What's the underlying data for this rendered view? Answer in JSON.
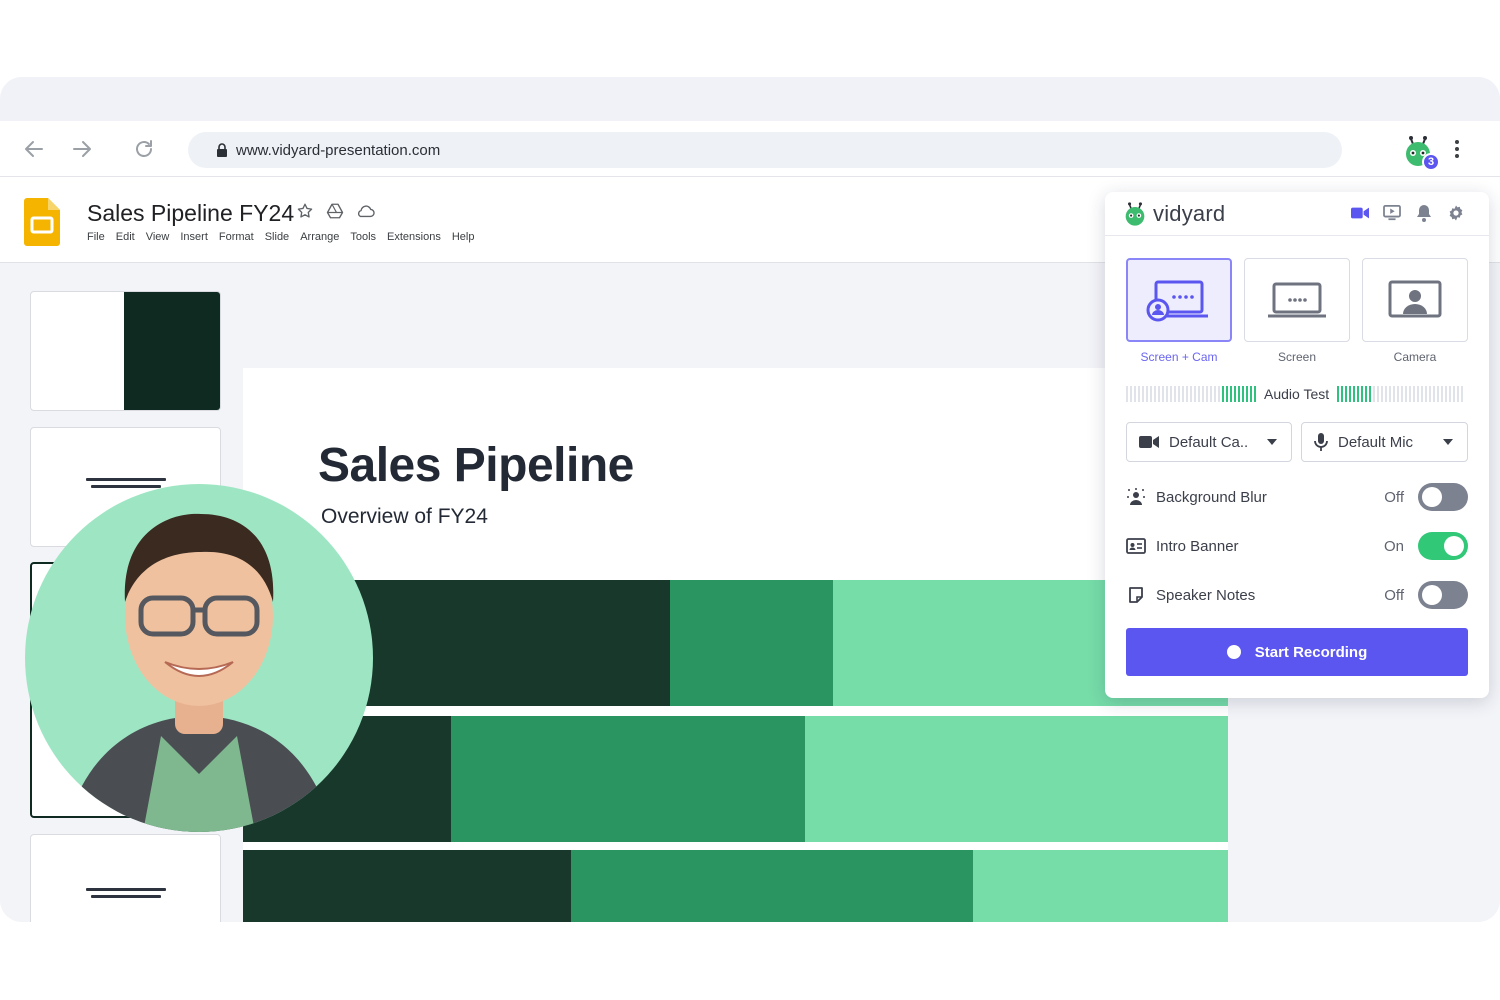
{
  "browser": {
    "url": "www.vidyard-presentation.com",
    "extension_badge": "3"
  },
  "doc": {
    "title": "Sales Pipeline FY24",
    "menu": [
      "File",
      "Edit",
      "View",
      "Insert",
      "Format",
      "Slide",
      "Arrange",
      "Tools",
      "Extensions",
      "Help"
    ]
  },
  "slide": {
    "title": "Sales Pipeline",
    "subtitle": "Overview of FY24"
  },
  "popup": {
    "logo_text": "vidyard",
    "modes": [
      {
        "label": "Screen + Cam",
        "active": true
      },
      {
        "label": "Screen",
        "active": false
      },
      {
        "label": "Camera",
        "active": false
      }
    ],
    "audio_test_label": "Audio Test",
    "camera_select": "Default Ca..",
    "mic_select": "Default Mic",
    "options": [
      {
        "label": "Background Blur",
        "state": "Off",
        "on": false
      },
      {
        "label": "Intro Banner",
        "state": "On",
        "on": true
      },
      {
        "label": "Speaker Notes",
        "state": "Off",
        "on": false
      }
    ],
    "record_label": "Start Recording"
  },
  "colors": {
    "accent": "#5b56f0",
    "toggle_on": "#31c878",
    "bar_dark": "#17382a",
    "bar_mid": "#2a9560",
    "bar_light": "#76dca8"
  }
}
